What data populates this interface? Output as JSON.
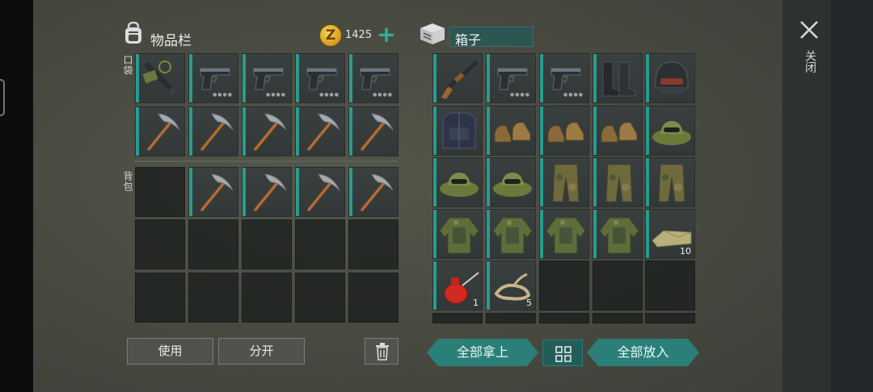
{
  "inventory": {
    "title": "物品栏",
    "pockets_label": "口袋",
    "backpack_label": "背包",
    "coins": "1425",
    "coin_symbol": "Z",
    "coin_plus": "+"
  },
  "box": {
    "title": "箱子"
  },
  "inventory_slots": [
    {
      "item": "melee-weapon",
      "count": ""
    },
    {
      "item": "pistol",
      "count": ""
    },
    {
      "item": "pistol",
      "count": ""
    },
    {
      "item": "pistol",
      "count": ""
    },
    {
      "item": "pistol",
      "count": ""
    },
    {
      "item": "pickaxe",
      "count": ""
    },
    {
      "item": "pickaxe",
      "count": ""
    },
    {
      "item": "pickaxe",
      "count": ""
    },
    {
      "item": "pickaxe",
      "count": ""
    },
    {
      "item": "pickaxe",
      "count": ""
    },
    {
      "item": "",
      "count": ""
    },
    {
      "item": "pickaxe",
      "count": ""
    },
    {
      "item": "pickaxe",
      "count": ""
    },
    {
      "item": "pickaxe",
      "count": ""
    },
    {
      "item": "pickaxe",
      "count": ""
    }
  ],
  "box_slots": [
    {
      "item": "shotgun",
      "count": ""
    },
    {
      "item": "pistol",
      "count": ""
    },
    {
      "item": "pistol",
      "count": ""
    },
    {
      "item": "boots-black",
      "count": ""
    },
    {
      "item": "helmet",
      "count": ""
    },
    {
      "item": "tactical-vest",
      "count": ""
    },
    {
      "item": "boots-brown",
      "count": ""
    },
    {
      "item": "boots-brown",
      "count": ""
    },
    {
      "item": "boots-brown",
      "count": ""
    },
    {
      "item": "boonie-hat",
      "count": ""
    },
    {
      "item": "boonie-hat",
      "count": ""
    },
    {
      "item": "boonie-hat",
      "count": ""
    },
    {
      "item": "camo-pants",
      "count": ""
    },
    {
      "item": "camo-pants",
      "count": ""
    },
    {
      "item": "camo-pants",
      "count": ""
    },
    {
      "item": "camo-jacket",
      "count": ""
    },
    {
      "item": "camo-jacket",
      "count": ""
    },
    {
      "item": "camo-jacket",
      "count": ""
    },
    {
      "item": "camo-jacket",
      "count": ""
    },
    {
      "item": "cloth",
      "count": "10"
    },
    {
      "item": "oil-can",
      "count": "1"
    },
    {
      "item": "rope",
      "count": "5"
    },
    {
      "item": "",
      "count": ""
    },
    {
      "item": "",
      "count": ""
    },
    {
      "item": "",
      "count": ""
    }
  ],
  "buttons": {
    "use": "使用",
    "split": "分开",
    "take_all": "全部拿上",
    "put_all": "全部放入",
    "close": "关闭"
  },
  "colors": {
    "accent": "#2a9b91",
    "title_field": "#2c5553",
    "button_teal": "#2b7f79"
  }
}
